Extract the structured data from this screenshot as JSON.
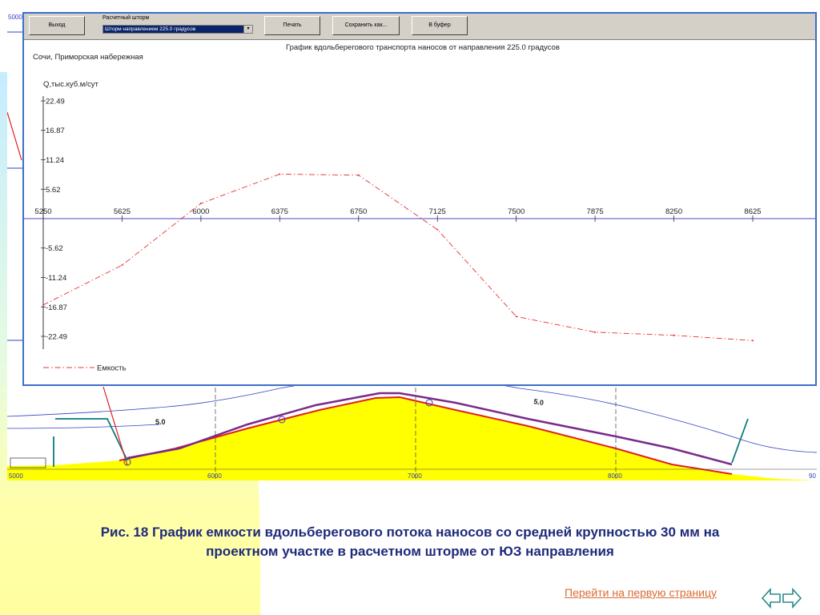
{
  "toolbar": {
    "exit_label": "Выход",
    "storm_label": "Расчетный шторм",
    "storm_selected": "Шторм направлением 225.0 градусов",
    "print_label": "Печать",
    "save_label": "Сохранить как...",
    "clipboard_label": "В буфер"
  },
  "chart_data": {
    "type": "line",
    "title": "График вдольберегового транспорта наносов от направления 225.0 градусов",
    "subtitle": "Сочи, Приморская набережная",
    "ylabel": "Q,тыс.куб.м/сут",
    "xlabel": "",
    "xlim": [
      5250,
      8625
    ],
    "ylim": [
      -22.49,
      22.49
    ],
    "x_ticks": [
      "5250",
      "5625",
      "6000",
      "6375",
      "6750",
      "7125",
      "7500",
      "7875",
      "8250",
      "8625"
    ],
    "y_ticks": [
      "22.49",
      "16.87",
      "11.24",
      "5.62",
      "-5.62",
      "-11.24",
      "-16.87",
      "-22.49"
    ],
    "series": [
      {
        "name": "Емкость",
        "color": "#e83030",
        "x": [
          5250,
          5625,
          6000,
          6375,
          6750,
          7125,
          7500,
          7875,
          8250,
          8625
        ],
        "y": [
          -16.5,
          -8.9,
          2.9,
          8.5,
          8.3,
          -2.1,
          -18.7,
          -21.7,
          -22.3,
          -23.3
        ]
      }
    ],
    "legend": "bottom-left",
    "grid": false
  },
  "cad": {
    "x_labels": [
      "5000",
      "6000",
      "7000",
      "8000",
      "90"
    ],
    "corner_label": "5000",
    "contour_labels": [
      "5.0",
      "5.0"
    ]
  },
  "caption": {
    "line1": "Рис. 18 График емкости вдольберегового потока наносов со средней крупностью 30 мм на",
    "line2": "проектном участке в расчетном шторме от ЮЗ направления"
  },
  "nav": {
    "first_page_link": "Перейти на первую страницу"
  },
  "colors": {
    "background_yellow": "#ffff99",
    "background_cyan": "#ccf2ff",
    "caption": "#1f2a7a",
    "link": "#d86c33",
    "window_border": "#3d6fc9",
    "axis": "#4a4ac8",
    "series": "#e83030"
  }
}
